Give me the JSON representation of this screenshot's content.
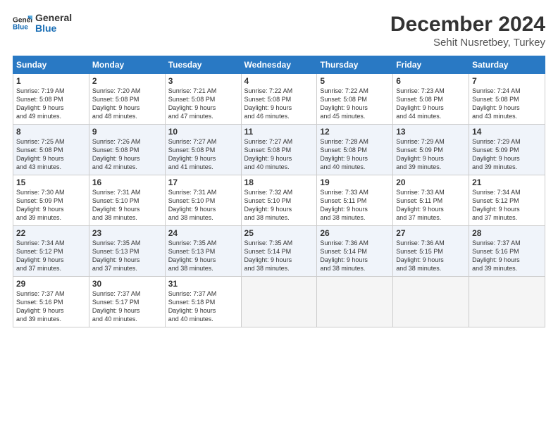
{
  "header": {
    "logo_line1": "General",
    "logo_line2": "Blue",
    "title": "December 2024",
    "subtitle": "Sehit Nusretbey, Turkey"
  },
  "columns": [
    "Sunday",
    "Monday",
    "Tuesday",
    "Wednesday",
    "Thursday",
    "Friday",
    "Saturday"
  ],
  "weeks": [
    [
      {
        "day": "1",
        "info": "Sunrise: 7:19 AM\nSunset: 5:08 PM\nDaylight: 9 hours\nand 49 minutes."
      },
      {
        "day": "2",
        "info": "Sunrise: 7:20 AM\nSunset: 5:08 PM\nDaylight: 9 hours\nand 48 minutes."
      },
      {
        "day": "3",
        "info": "Sunrise: 7:21 AM\nSunset: 5:08 PM\nDaylight: 9 hours\nand 47 minutes."
      },
      {
        "day": "4",
        "info": "Sunrise: 7:22 AM\nSunset: 5:08 PM\nDaylight: 9 hours\nand 46 minutes."
      },
      {
        "day": "5",
        "info": "Sunrise: 7:22 AM\nSunset: 5:08 PM\nDaylight: 9 hours\nand 45 minutes."
      },
      {
        "day": "6",
        "info": "Sunrise: 7:23 AM\nSunset: 5:08 PM\nDaylight: 9 hours\nand 44 minutes."
      },
      {
        "day": "7",
        "info": "Sunrise: 7:24 AM\nSunset: 5:08 PM\nDaylight: 9 hours\nand 43 minutes."
      }
    ],
    [
      {
        "day": "8",
        "info": "Sunrise: 7:25 AM\nSunset: 5:08 PM\nDaylight: 9 hours\nand 43 minutes."
      },
      {
        "day": "9",
        "info": "Sunrise: 7:26 AM\nSunset: 5:08 PM\nDaylight: 9 hours\nand 42 minutes."
      },
      {
        "day": "10",
        "info": "Sunrise: 7:27 AM\nSunset: 5:08 PM\nDaylight: 9 hours\nand 41 minutes."
      },
      {
        "day": "11",
        "info": "Sunrise: 7:27 AM\nSunset: 5:08 PM\nDaylight: 9 hours\nand 40 minutes."
      },
      {
        "day": "12",
        "info": "Sunrise: 7:28 AM\nSunset: 5:08 PM\nDaylight: 9 hours\nand 40 minutes."
      },
      {
        "day": "13",
        "info": "Sunrise: 7:29 AM\nSunset: 5:09 PM\nDaylight: 9 hours\nand 39 minutes."
      },
      {
        "day": "14",
        "info": "Sunrise: 7:29 AM\nSunset: 5:09 PM\nDaylight: 9 hours\nand 39 minutes."
      }
    ],
    [
      {
        "day": "15",
        "info": "Sunrise: 7:30 AM\nSunset: 5:09 PM\nDaylight: 9 hours\nand 39 minutes."
      },
      {
        "day": "16",
        "info": "Sunrise: 7:31 AM\nSunset: 5:10 PM\nDaylight: 9 hours\nand 38 minutes."
      },
      {
        "day": "17",
        "info": "Sunrise: 7:31 AM\nSunset: 5:10 PM\nDaylight: 9 hours\nand 38 minutes."
      },
      {
        "day": "18",
        "info": "Sunrise: 7:32 AM\nSunset: 5:10 PM\nDaylight: 9 hours\nand 38 minutes."
      },
      {
        "day": "19",
        "info": "Sunrise: 7:33 AM\nSunset: 5:11 PM\nDaylight: 9 hours\nand 38 minutes."
      },
      {
        "day": "20",
        "info": "Sunrise: 7:33 AM\nSunset: 5:11 PM\nDaylight: 9 hours\nand 37 minutes."
      },
      {
        "day": "21",
        "info": "Sunrise: 7:34 AM\nSunset: 5:12 PM\nDaylight: 9 hours\nand 37 minutes."
      }
    ],
    [
      {
        "day": "22",
        "info": "Sunrise: 7:34 AM\nSunset: 5:12 PM\nDaylight: 9 hours\nand 37 minutes."
      },
      {
        "day": "23",
        "info": "Sunrise: 7:35 AM\nSunset: 5:13 PM\nDaylight: 9 hours\nand 37 minutes."
      },
      {
        "day": "24",
        "info": "Sunrise: 7:35 AM\nSunset: 5:13 PM\nDaylight: 9 hours\nand 38 minutes."
      },
      {
        "day": "25",
        "info": "Sunrise: 7:35 AM\nSunset: 5:14 PM\nDaylight: 9 hours\nand 38 minutes."
      },
      {
        "day": "26",
        "info": "Sunrise: 7:36 AM\nSunset: 5:14 PM\nDaylight: 9 hours\nand 38 minutes."
      },
      {
        "day": "27",
        "info": "Sunrise: 7:36 AM\nSunset: 5:15 PM\nDaylight: 9 hours\nand 38 minutes."
      },
      {
        "day": "28",
        "info": "Sunrise: 7:37 AM\nSunset: 5:16 PM\nDaylight: 9 hours\nand 39 minutes."
      }
    ],
    [
      {
        "day": "29",
        "info": "Sunrise: 7:37 AM\nSunset: 5:16 PM\nDaylight: 9 hours\nand 39 minutes."
      },
      {
        "day": "30",
        "info": "Sunrise: 7:37 AM\nSunset: 5:17 PM\nDaylight: 9 hours\nand 40 minutes."
      },
      {
        "day": "31",
        "info": "Sunrise: 7:37 AM\nSunset: 5:18 PM\nDaylight: 9 hours\nand 40 minutes."
      },
      {
        "day": "",
        "info": ""
      },
      {
        "day": "",
        "info": ""
      },
      {
        "day": "",
        "info": ""
      },
      {
        "day": "",
        "info": ""
      }
    ]
  ]
}
